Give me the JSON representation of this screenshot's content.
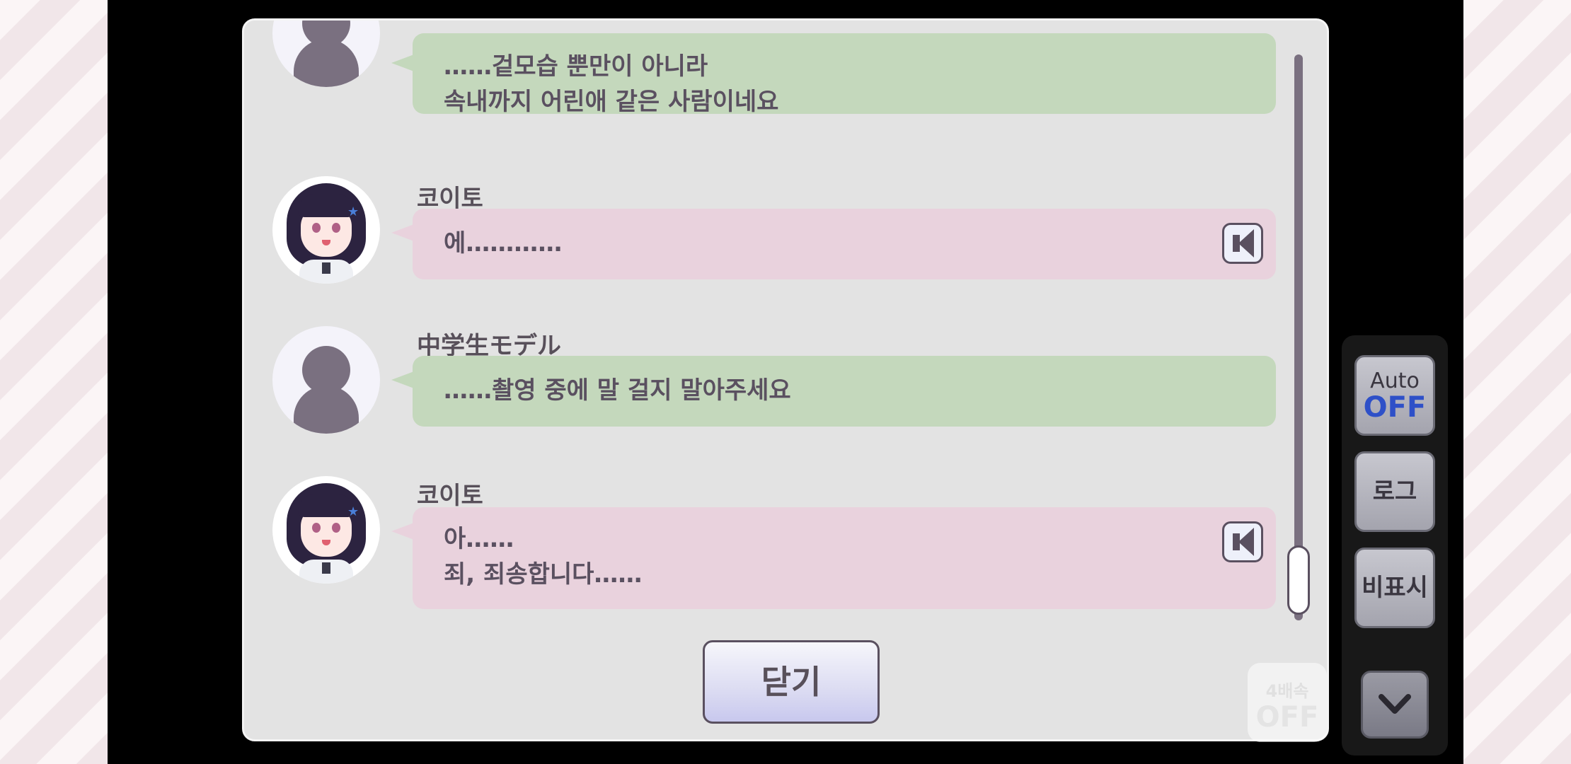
{
  "log": {
    "entries": [
      {
        "speaker": "",
        "avatar": "silhouette",
        "bubble_color": "green",
        "lines": [
          "……겉모습 뿐만이 아니라",
          "속내까지 어린애 같은 사람이네요"
        ],
        "has_voice": false
      },
      {
        "speaker": "코이토",
        "avatar": "koito",
        "bubble_color": "pink",
        "lines": [
          "에…………"
        ],
        "has_voice": true
      },
      {
        "speaker": "中学生モデル",
        "avatar": "silhouette",
        "bubble_color": "green",
        "lines": [
          "……촬영 중에 말 걸지 말아주세요"
        ],
        "has_voice": false
      },
      {
        "speaker": "코이토",
        "avatar": "koito",
        "bubble_color": "pink",
        "lines": [
          "아……",
          "죄, 죄송합니다……"
        ],
        "has_voice": true
      }
    ],
    "close_label": "닫기",
    "scroll_position": 1.0
  },
  "speed_toggle": {
    "label_top": "4배속",
    "label_bottom": "OFF"
  },
  "side_menu": {
    "auto": {
      "label_top": "Auto",
      "label_bottom": "OFF"
    },
    "log_label": "로그",
    "hide_label": "비표시",
    "collapse_icon": "chevron-down-icon"
  },
  "colors": {
    "bubble_green": "#c4d8bc",
    "bubble_pink": "#e9d2dd",
    "panel": "#e3e3e3",
    "auto_off": "#2e50c8"
  }
}
